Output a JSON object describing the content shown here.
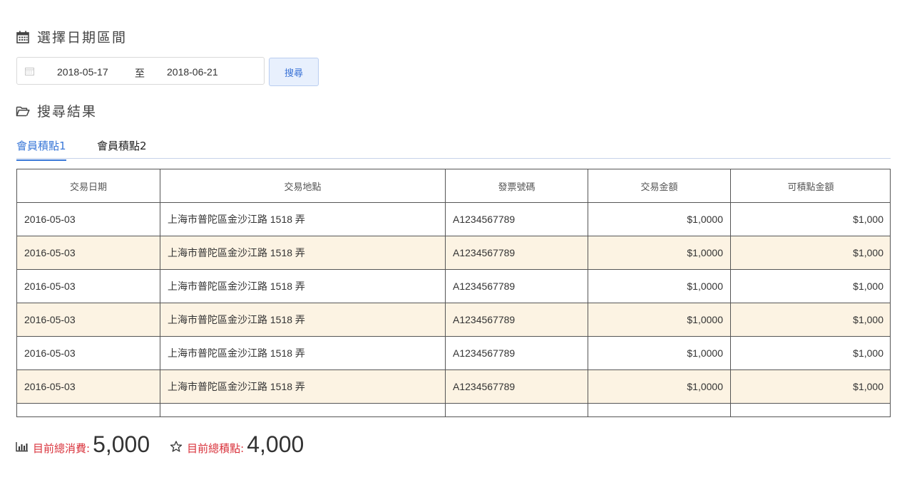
{
  "date_section": {
    "title": "選擇日期區間",
    "start_date": "2018-05-17",
    "separator": "至",
    "end_date": "2018-06-21",
    "search_label": "搜尋"
  },
  "result_section": {
    "title": "搜尋結果"
  },
  "tabs": [
    {
      "label": "會員積點1",
      "active": true
    },
    {
      "label": "會員積點2",
      "active": false
    }
  ],
  "table": {
    "columns": [
      "交易日期",
      "交易地點",
      "發票號碼",
      "交易金額",
      "可積點金額"
    ],
    "rows": [
      [
        "2016-05-03",
        "上海市普陀區金沙江路 1518 弄",
        "A1234567789",
        "$1,0000",
        "$1,000"
      ],
      [
        "2016-05-03",
        "上海市普陀區金沙江路 1518 弄",
        "A1234567789",
        "$1,0000",
        "$1,000"
      ],
      [
        "2016-05-03",
        "上海市普陀區金沙江路 1518 弄",
        "A1234567789",
        "$1,0000",
        "$1,000"
      ],
      [
        "2016-05-03",
        "上海市普陀區金沙江路 1518 弄",
        "A1234567789",
        "$1,0000",
        "$1,000"
      ],
      [
        "2016-05-03",
        "上海市普陀區金沙江路 1518 弄",
        "A1234567789",
        "$1,0000",
        "$1,000"
      ],
      [
        "2016-05-03",
        "上海市普陀區金沙江路 1518 弄",
        "A1234567789",
        "$1,0000",
        "$1,000"
      ]
    ]
  },
  "summary": {
    "spend_label": "目前總消費:",
    "spend_value": "5,000",
    "points_label": "目前總積點:",
    "points_value": "4,000"
  },
  "colors": {
    "accent": "#3a78d8",
    "alt_row": "#fcf3e3",
    "summary_label": "#d9323b"
  },
  "icons": {
    "date_title": "calendar-icon",
    "result_title": "folder-open-icon",
    "date_input": "calendar-small-icon",
    "spend": "bar-chart-icon",
    "points": "star-outline-icon"
  }
}
